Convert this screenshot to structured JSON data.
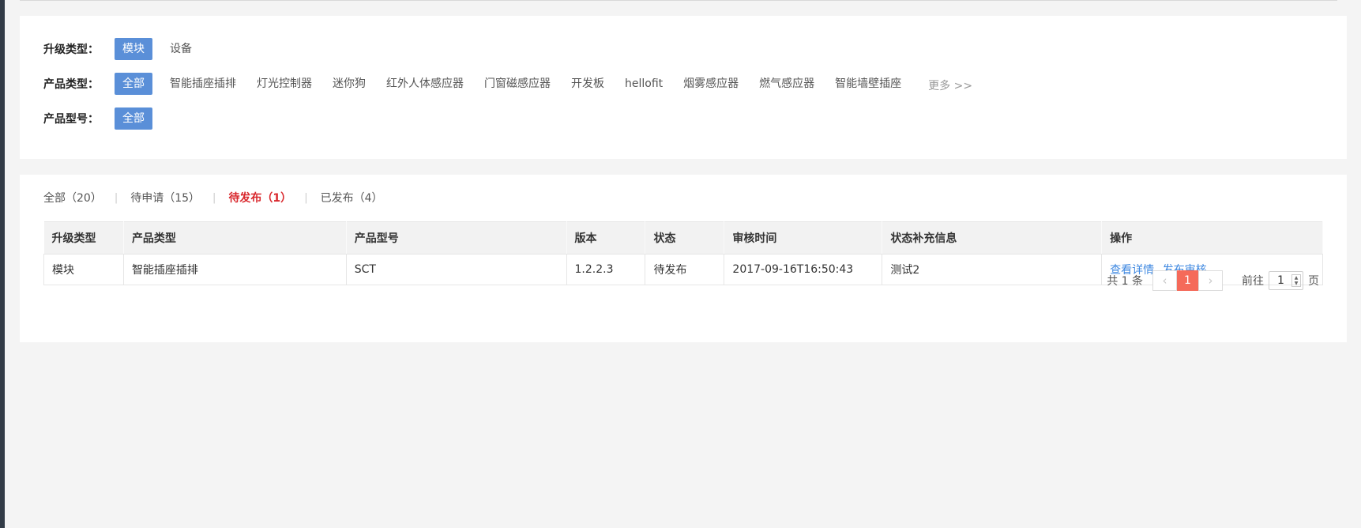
{
  "filters": {
    "upgrade_type": {
      "label": "升级类型：",
      "options": [
        "模块",
        "设备"
      ],
      "selected": "模块"
    },
    "product_type": {
      "label": "产品类型：",
      "options": [
        "全部",
        "智能插座插排",
        "灯光控制器",
        "迷你狗",
        "红外人体感应器",
        "门窗磁感应器",
        "开发板",
        "hellofit",
        "烟雾感应器",
        "燃气感应器",
        "智能墙壁插座"
      ],
      "selected": "全部",
      "more": "更多 >>"
    },
    "product_model": {
      "label": "产品型号：",
      "options": [
        "全部"
      ],
      "selected": "全部"
    }
  },
  "tabs": [
    {
      "label": "全部（20）",
      "active": false
    },
    {
      "label": "待申请（15）",
      "active": false
    },
    {
      "label": "待发布（1）",
      "active": true
    },
    {
      "label": "已发布（4）",
      "active": false
    }
  ],
  "tab_separator": "|",
  "table": {
    "headers": [
      "升级类型",
      "产品类型",
      "产品型号",
      "版本",
      "状态",
      "审核时间",
      "状态补充信息",
      "操作"
    ],
    "rows": [
      {
        "upgrade_type": "模块",
        "product_type": "智能插座插排",
        "product_model": "SCT",
        "version": "1.2.2.3",
        "status": "待发布",
        "review_time": "2017-09-16T16:50:43",
        "status_info": "测试2",
        "actions": [
          "查看详情",
          "发布审核"
        ]
      }
    ]
  },
  "pagination": {
    "total": "共 1 条",
    "prev": "‹",
    "current": "1",
    "next": "›",
    "goto_prefix": "前往",
    "goto_value": "1",
    "goto_suffix": "页"
  },
  "colors": {
    "accent_blue": "#5a8fd8",
    "active_tab_red": "#d9282d",
    "link_blue": "#3d87e0",
    "page_active": "#f56a5a"
  }
}
